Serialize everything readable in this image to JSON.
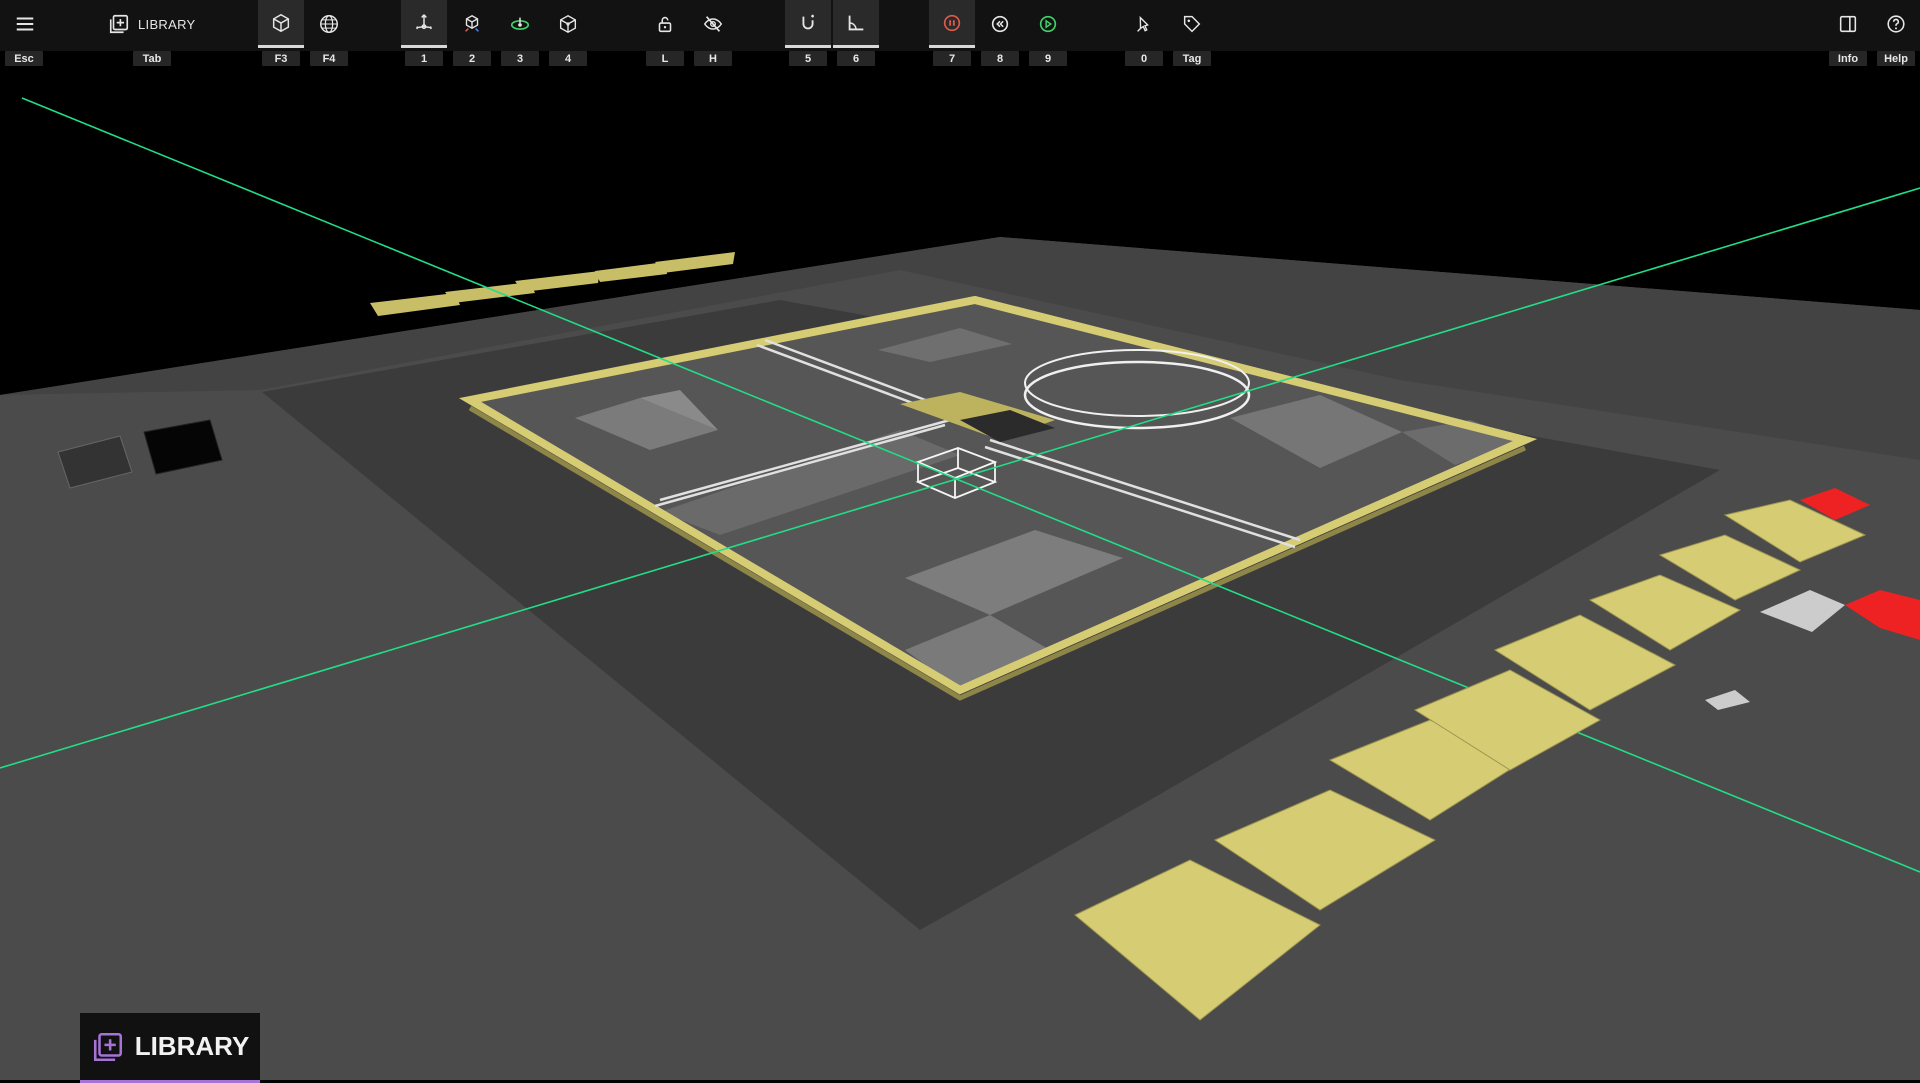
{
  "toolbar": {
    "library_label": "LIBRARY",
    "keys": {
      "menu": "Esc",
      "library": "Tab",
      "local": "F3",
      "world": "F4",
      "move": "1",
      "scale": "2",
      "rotate": "3",
      "transform": "4",
      "lock": "L",
      "hide": "H",
      "snap": "5",
      "ruler": "6",
      "pause": "7",
      "rewind": "8",
      "play": "9",
      "inspect": "0",
      "tag": "Tag",
      "info": "Info",
      "help": "Help"
    }
  },
  "icons": {
    "menu": "hamburger-icon",
    "library": "library-add-icon",
    "local": "cube-icon",
    "world": "globe-icon",
    "move": "move-gizmo-icon",
    "scale": "scale-gizmo-icon",
    "rotate": "rotate-gizmo-icon",
    "transform": "transform-gizmo-icon",
    "lock": "lock-icon",
    "hide": "eye-off-icon",
    "snap": "magnet-icon",
    "ruler": "angle-ruler-icon",
    "pause": "pause-icon",
    "rewind": "rewind-icon",
    "play": "play-icon",
    "inspect": "inspect-icon",
    "tag": "tag-icon",
    "info": "sidebar-panel-icon",
    "help": "help-icon"
  },
  "library_panel": {
    "label": "LIBRARY"
  },
  "colors": {
    "accent_purple": "#a673d6",
    "pause_red": "#e05a4a",
    "play_green": "#3fd46a",
    "axis_green": "#22dd88",
    "model_yellow": "#d6cc74",
    "marker_red": "#ee2222"
  }
}
